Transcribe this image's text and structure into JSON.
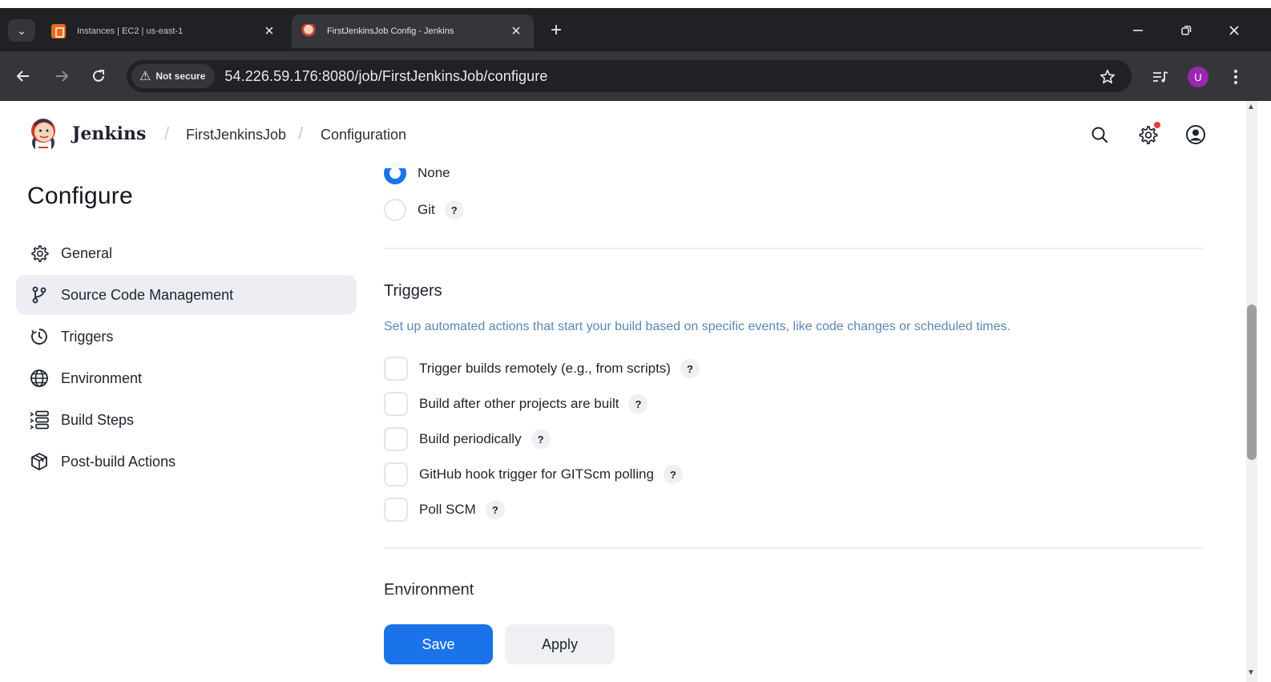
{
  "browser": {
    "tabs": [
      {
        "title": "Instances | EC2 | us-east-1",
        "favicon": "aws-ec2-icon",
        "active": false
      },
      {
        "title": "FirstJenkinsJob Config - Jenkins",
        "favicon": "jenkins-icon",
        "active": true
      }
    ],
    "security_chip": "Not secure",
    "url_host": "54.226.59.176",
    "url_path": ":8080/job/FirstJenkinsJob/configure",
    "profile_initial": "U"
  },
  "header": {
    "brand": "Jenkins",
    "breadcrumbs": [
      "FirstJenkinsJob",
      "Configuration"
    ]
  },
  "sidebar": {
    "title": "Configure",
    "items": [
      {
        "label": "General",
        "icon": "gear-icon",
        "active": false
      },
      {
        "label": "Source Code Management",
        "icon": "git-branch-icon",
        "active": true
      },
      {
        "label": "Triggers",
        "icon": "timer-icon",
        "active": false
      },
      {
        "label": "Environment",
        "icon": "globe-icon",
        "active": false
      },
      {
        "label": "Build Steps",
        "icon": "list-icon",
        "active": false
      },
      {
        "label": "Post-build Actions",
        "icon": "package-icon",
        "active": false
      }
    ]
  },
  "scm": {
    "options": [
      {
        "label": "None",
        "checked": true
      },
      {
        "label": "Git",
        "checked": false,
        "help": "?"
      }
    ]
  },
  "triggers": {
    "title": "Triggers",
    "description": "Set up automated actions that start your build based on specific events, like code changes or scheduled times.",
    "options": [
      {
        "label": "Trigger builds remotely (e.g., from scripts)",
        "checked": false,
        "help": "?"
      },
      {
        "label": "Build after other projects are built",
        "checked": false,
        "help": "?"
      },
      {
        "label": "Build periodically",
        "checked": false,
        "help": "?"
      },
      {
        "label": "GitHub hook trigger for GITScm polling",
        "checked": false,
        "help": "?"
      },
      {
        "label": "Poll SCM",
        "checked": false,
        "help": "?"
      }
    ]
  },
  "environment": {
    "title": "Environment"
  },
  "actions": {
    "save_label": "Save",
    "apply_label": "Apply"
  },
  "colors": {
    "accent": "#1a73e8",
    "description_text": "#5b87b8",
    "active_nav_bg": "#eceef3"
  }
}
